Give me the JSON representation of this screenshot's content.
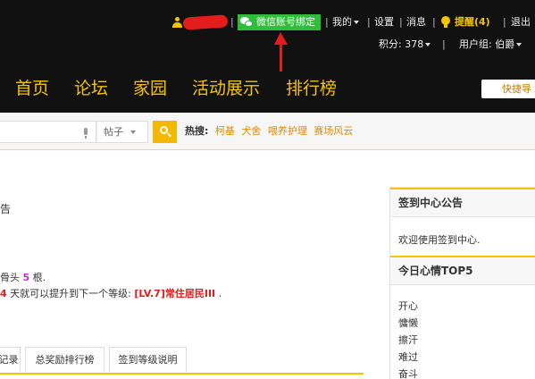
{
  "topbar": {
    "wechat_bind_label": "微信账号绑定",
    "my_label": "我的",
    "settings_label": "设置",
    "messages_label": "消息",
    "reminder_label": "提醒(4)",
    "logout_label": "退出",
    "points_label": "积分: 378",
    "usergroup_label": "用户组: 伯爵"
  },
  "nav": {
    "items": [
      {
        "label": "首页"
      },
      {
        "label": "论坛"
      },
      {
        "label": "家园"
      },
      {
        "label": "活动展示"
      },
      {
        "label": "排行榜"
      }
    ],
    "quick_label": "快捷导"
  },
  "search": {
    "select_value": "帖子",
    "hot_label": "热搜:",
    "hot_keywords": [
      "柯基",
      "犬舍",
      "喂养护理",
      "赛场风云"
    ]
  },
  "main": {
    "fragment_top": "告",
    "line1_pre": "骨头",
    "line1_num": "5",
    "line1_post": "根.",
    "line2_num": "4",
    "line2_text": "天就可以提升到下一个等级:",
    "line2_level": "[LV.7]常住居民III",
    "line2_end": ".",
    "tabs": [
      "记录",
      "总奖励排行榜",
      "签到等级说明"
    ]
  },
  "sidebar": {
    "notice_title": "签到中心公告",
    "notice_text": "欢迎使用签到中心.",
    "mood_title": "今日心情TOP5",
    "moods": [
      "开心",
      "慵懒",
      "擦汗",
      "难过",
      "奋斗"
    ]
  },
  "colors": {
    "accent": "#f5c400",
    "topbar_bg": "#111111",
    "wechat_green": "#2fbd3c",
    "annotation_red": "#e31c1c"
  }
}
